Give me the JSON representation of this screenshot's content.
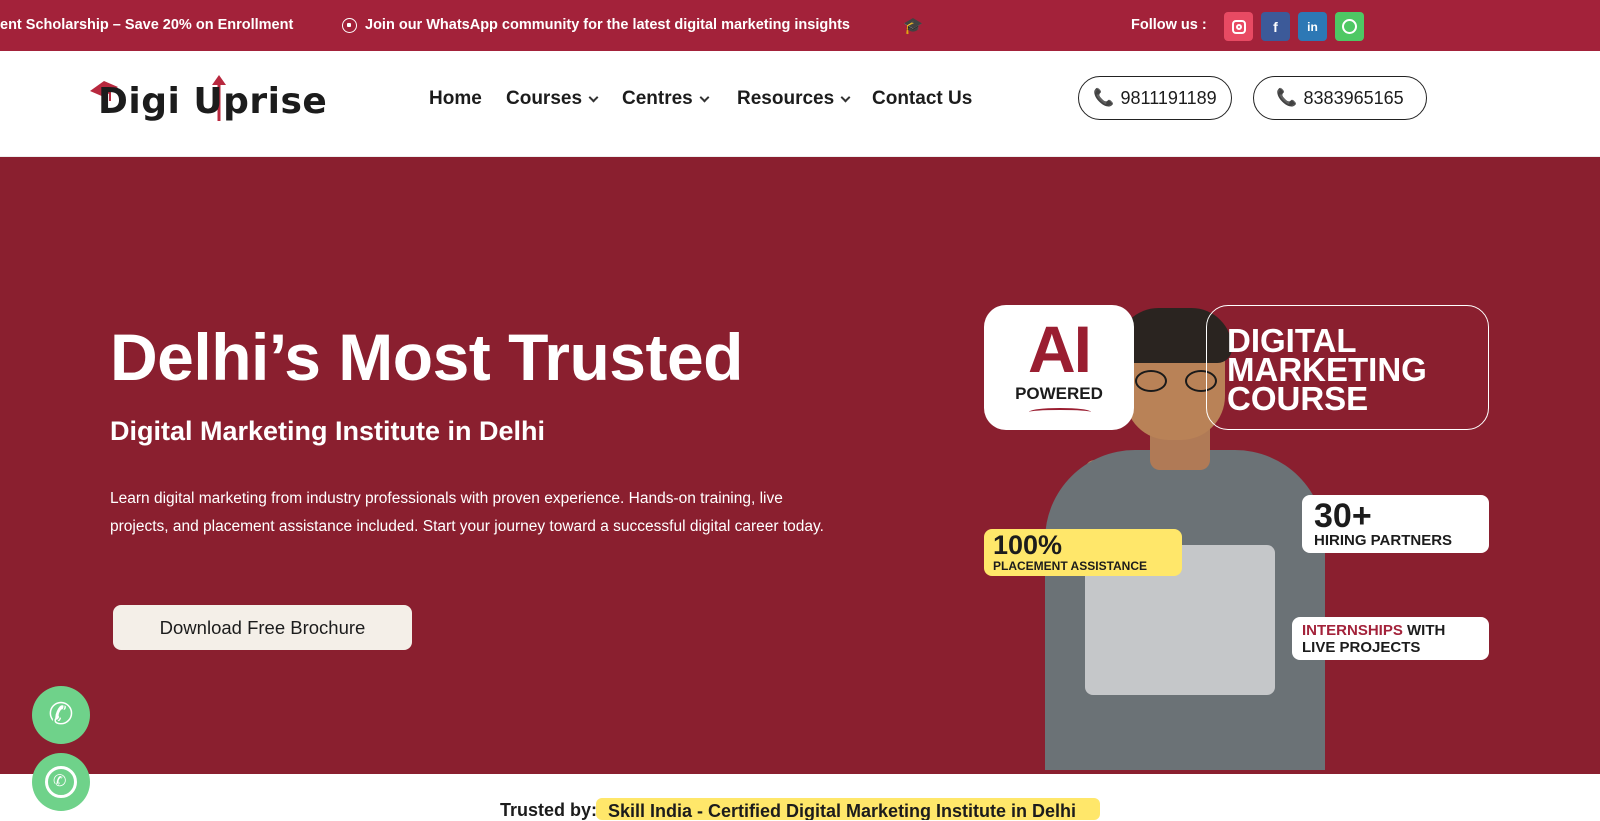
{
  "topbar": {
    "announcement_scholarship": "ent Scholarship – Save 20% on Enrollment",
    "announcement_whatsapp": "Join our WhatsApp community for the latest digital marketing insights",
    "follow_label": "Follow us :",
    "social": [
      {
        "name": "instagram",
        "letter": ""
      },
      {
        "name": "facebook",
        "letter": "f"
      },
      {
        "name": "linkedin",
        "letter": "in"
      },
      {
        "name": "whatsapp",
        "letter": ""
      }
    ]
  },
  "header": {
    "logo_text": "Digi Uprise",
    "nav": [
      {
        "label": "Home",
        "dropdown": false
      },
      {
        "label": "Courses",
        "dropdown": true
      },
      {
        "label": "Centres",
        "dropdown": true
      },
      {
        "label": "Resources",
        "dropdown": true
      },
      {
        "label": "Contact Us",
        "dropdown": false
      }
    ],
    "phones": [
      "9811191189",
      "8383965165"
    ]
  },
  "hero": {
    "title": "Delhi’s Most Trusted",
    "subtitle": "Digital Marketing Institute in Delhi",
    "description": "Learn digital marketing from industry professionals with proven experience. Hands-on training, live projects, and placement assistance included. Start your journey toward a successful digital career today.",
    "cta": "Download Free Brochure",
    "badges": {
      "ai_big": "AI",
      "ai_small": "POWERED",
      "course_line1": "DIGITAL",
      "course_line2": "MARKETING",
      "course_line3": "COURSE",
      "partners_big": "30+",
      "partners_small": "HIRING PARTNERS",
      "placement_big": "100%",
      "placement_small": "PLACEMENT ASSISTANCE",
      "internships_red": "INTERNSHIPS",
      "internships_rest": " WITH",
      "internships_line2": "LIVE PROJECTS"
    }
  },
  "bottom": {
    "trusted_label": "Trusted by:",
    "skill_badge": "Skill India - Certified Digital Marketing Institute in Delhi"
  },
  "colors": {
    "topbar": "#a3223a",
    "hero_bg": "#8a1f2f",
    "highlight_yellow": "#ffe76a",
    "fab_green": "#6fd28a"
  }
}
